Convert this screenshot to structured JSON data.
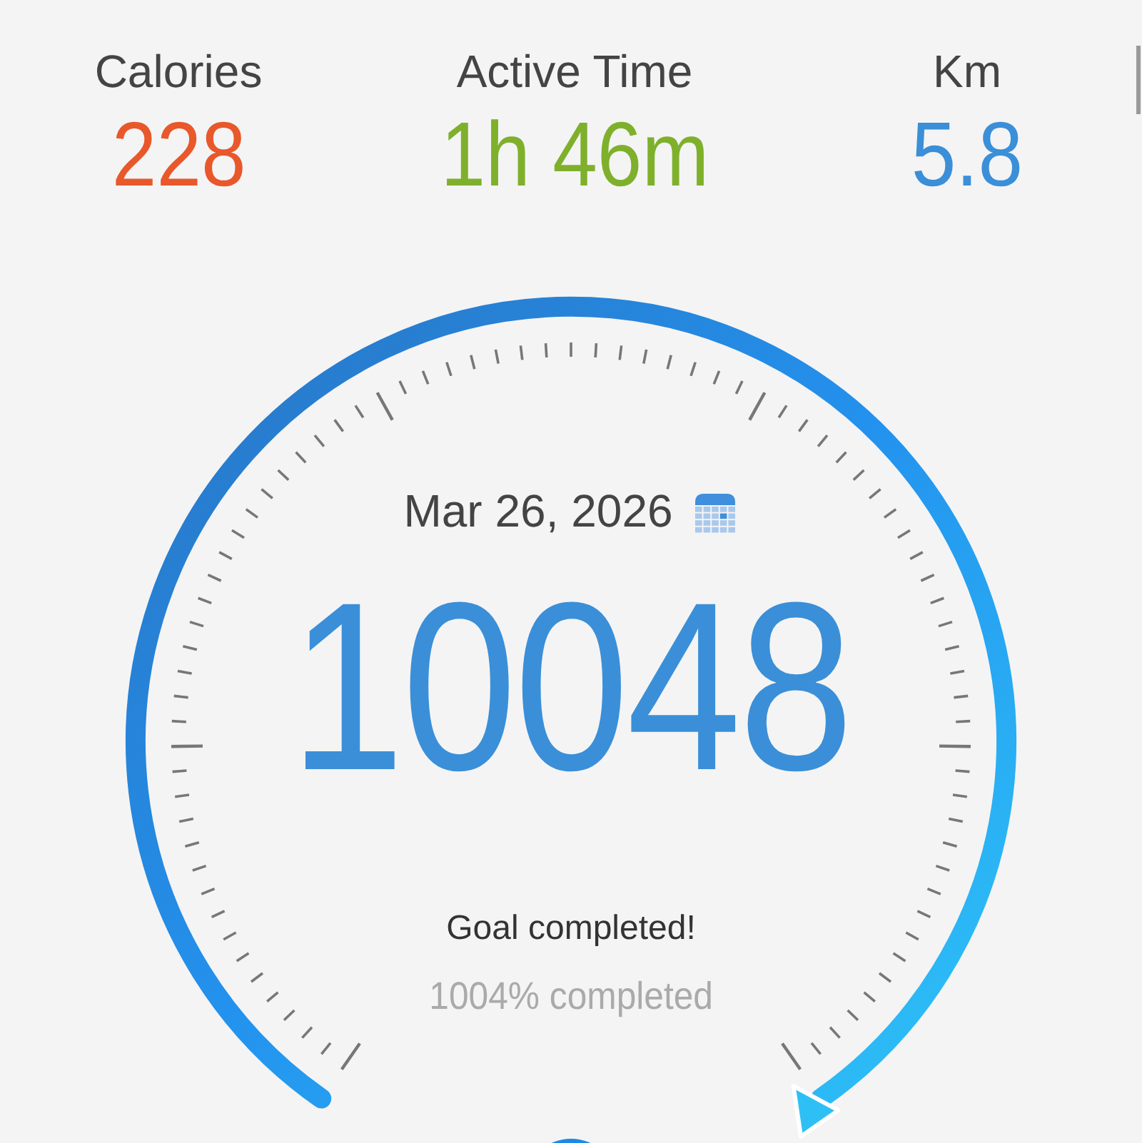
{
  "stats": [
    {
      "label": "Calories",
      "value": "228",
      "color": "#e8582b"
    },
    {
      "label": "Active Time",
      "value": "1h 46m",
      "color": "#7fb02c"
    },
    {
      "label": "Km",
      "value": "5.8",
      "color": "#3a8fd8"
    }
  ],
  "gauge": {
    "date": "Mar 26, 2026",
    "steps": "10048",
    "status": "Goal completed!",
    "percent": "1004% completed"
  }
}
